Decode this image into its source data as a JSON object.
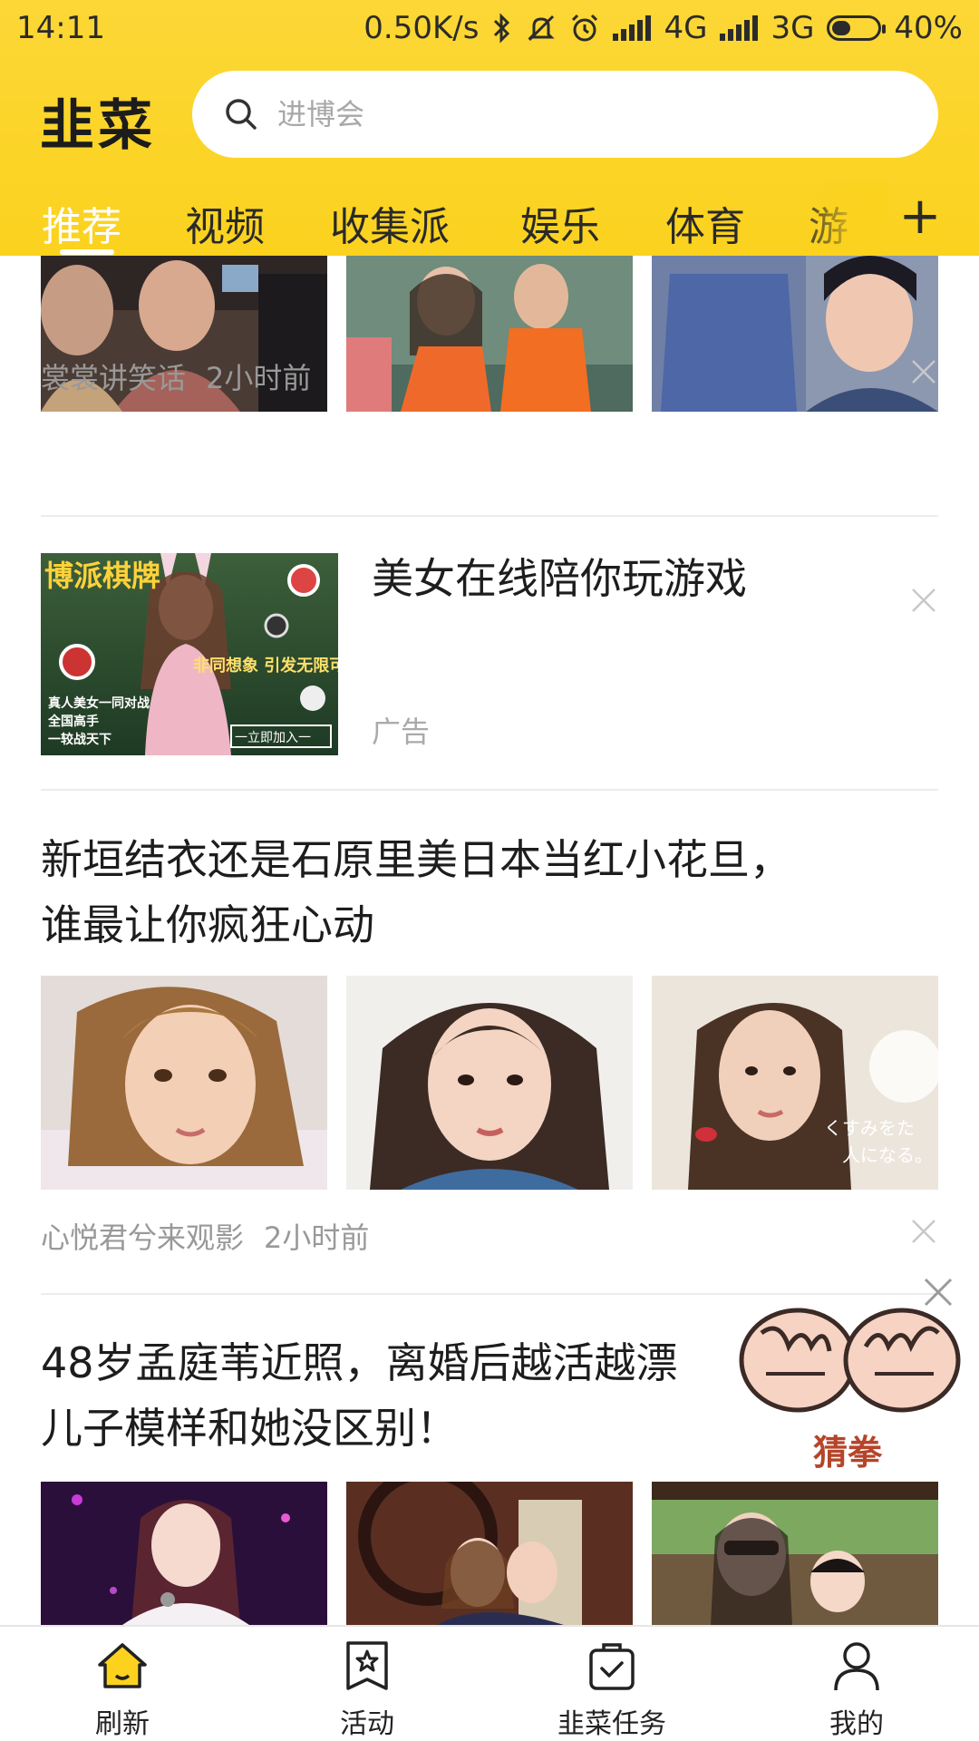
{
  "status_bar": {
    "time": "14:11",
    "net_speed": "0.50K/s",
    "network_1": "4G",
    "network_2": "3G",
    "battery": "40%",
    "icons": [
      "bluetooth-icon",
      "mute-icon",
      "alarm-icon",
      "signal-icon",
      "battery-icon"
    ]
  },
  "header": {
    "logo": "韭菜",
    "search_placeholder": "进博会",
    "accent_color": "#fbd21e"
  },
  "tabs": [
    {
      "label": "推荐",
      "active": true
    },
    {
      "label": "视频"
    },
    {
      "label": "收集派"
    },
    {
      "label": "娱乐"
    },
    {
      "label": "体育"
    },
    {
      "label": "游"
    }
  ],
  "tab_add_label": "+",
  "feed": [
    {
      "type": "gallery",
      "source": "裳裳讲笑话",
      "time": "2小时前"
    },
    {
      "type": "ad",
      "title": "美女在线陪你玩游戏",
      "label": "广告",
      "image_text": {
        "brand": "博派棋牌",
        "slogan": "非同想象 引发无限可能",
        "cta": "一立即加入一",
        "lines": [
          "真人美女一同对战",
          "全国高手",
          "一较战天下"
        ]
      }
    },
    {
      "type": "gallery",
      "title_line1": "新垣结衣还是石原里美日本当红小花旦，",
      "title_line2": "谁最让你疯狂心动",
      "source": "心悦君兮来观影",
      "time": "2小时前"
    },
    {
      "type": "gallery",
      "title_line1": "48岁孟庭苇近照，离婚后越活越漂",
      "title_line2": "儿子模样和她没区别！"
    }
  ],
  "floating_widget": {
    "label": "猜拳"
  },
  "bottom_nav": [
    {
      "label": "刷新",
      "icon": "home-icon"
    },
    {
      "label": "活动",
      "icon": "star-flag-icon"
    },
    {
      "label": "韭菜任务",
      "icon": "task-bag-icon"
    },
    {
      "label": "我的",
      "icon": "user-icon"
    }
  ]
}
